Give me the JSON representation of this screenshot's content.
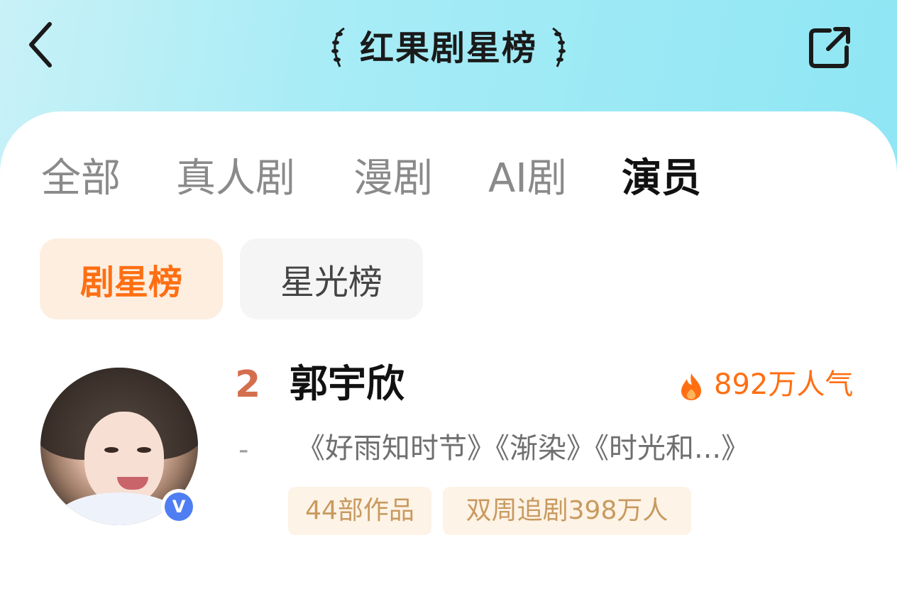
{
  "header": {
    "title": "红果剧星榜"
  },
  "tabs": [
    {
      "label": "全部",
      "active": false
    },
    {
      "label": "真人剧",
      "active": false
    },
    {
      "label": "漫剧",
      "active": false
    },
    {
      "label": "AI剧",
      "active": false
    },
    {
      "label": "演员",
      "active": true
    }
  ],
  "subtabs": [
    {
      "label": "剧星榜",
      "active": true
    },
    {
      "label": "星光榜",
      "active": false
    }
  ],
  "item": {
    "rank": "2",
    "name": "郭宇欣",
    "popularity": "892万人气",
    "trend": "-",
    "works": "《好雨知时节》《渐染》《时光和...》",
    "tags": [
      "44部作品",
      "双周追剧398万人"
    ],
    "verified_badge": "V"
  },
  "colors": {
    "accent": "#ff6f12",
    "rank": "#d46f4d",
    "tag_bg": "#fdf3e6",
    "tag_text": "#c89a60",
    "header_bg": "#9ee9f5",
    "verified": "#4f7ef3"
  },
  "icons": {
    "back": "chevron-left-icon",
    "share": "share-icon",
    "laurel": "laurel-icon",
    "fire": "fire-icon",
    "verified": "verified-icon"
  }
}
